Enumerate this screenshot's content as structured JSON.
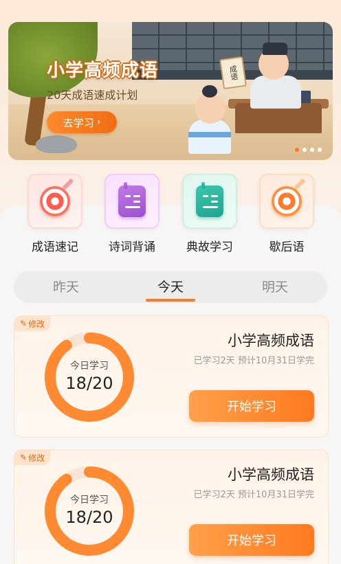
{
  "banner": {
    "title": "小学高频成语",
    "subtitle": "20天成语速成计划",
    "button_label": "去学习",
    "button_icon": "chevron-right-icon",
    "scroll_text": "成语",
    "dots_total": 4,
    "dots_active_index": 0,
    "accent_color": "#ff7a1e"
  },
  "actions": [
    {
      "label": "成语速记",
      "icon": "target-icon",
      "color": "red"
    },
    {
      "label": "诗词背诵",
      "icon": "card-icon",
      "color": "purple"
    },
    {
      "label": "典故学习",
      "icon": "card-icon",
      "color": "teal"
    },
    {
      "label": "歇后语",
      "icon": "target-icon",
      "color": "orange"
    }
  ],
  "day_tabs": {
    "items": [
      "昨天",
      "今天",
      "明天"
    ],
    "active_index": 1
  },
  "plans": [
    {
      "edit_label": "修改",
      "ring_label": "今日学习",
      "ring_value": "18/20",
      "progress": 0.9,
      "title": "小学高频成语",
      "subtitle": "已学习2天 预计10月31日学完",
      "button_label": "开始学习"
    },
    {
      "edit_label": "修改",
      "ring_label": "今日学习",
      "ring_value": "18/20",
      "progress": 0.9,
      "title": "小学高频成语",
      "subtitle": "已学习2天 预计10月31日学完",
      "button_label": "开始学习"
    }
  ]
}
